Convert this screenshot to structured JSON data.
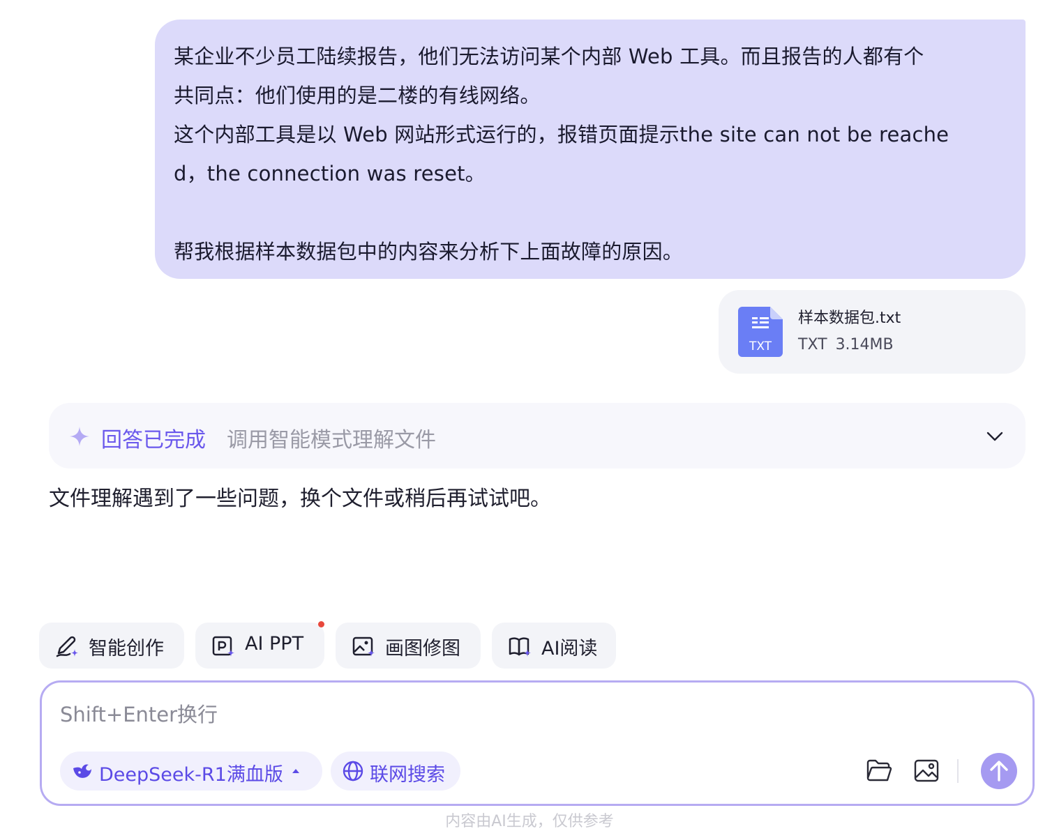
{
  "user_message": {
    "lines": [
      "某企业不少员工陆续报告，他们无法访问某个内部 Web 工具。而且报告的人都有个",
      "共同点：他们使用的是二楼的有线网络。",
      "这个内部工具是以 Web 网站形式运行的，报错页面提示the site can not be reache",
      "d，the connection was reset。",
      "",
      "帮我根据样本数据包中的内容来分析下上面故障的原因。"
    ]
  },
  "attachment": {
    "name": "样本数据包.txt",
    "type": "TXT",
    "size": "3.14MB",
    "icon": "txt-file-icon",
    "icon_label": "TXT",
    "accent": "#6a7ef5"
  },
  "response": {
    "status_title": "回答已完成",
    "status_subtitle": "调用智能模式理解文件",
    "answer_text": "文件理解遇到了一些问题，换个文件或稍后再试试吧。"
  },
  "tools": [
    {
      "label": "智能创作",
      "icon": "pen-sparkle-icon"
    },
    {
      "label": "AI PPT",
      "icon": "ppt-icon",
      "has_badge": true
    },
    {
      "label": "画图修图",
      "icon": "image-edit-icon"
    },
    {
      "label": "AI阅读",
      "icon": "book-read-icon"
    }
  ],
  "composer": {
    "placeholder": "Shift+Enter换行",
    "model_label": "DeepSeek-R1满血版",
    "model_icon": "deepseek-whale-icon",
    "web_search_label": "联网搜索",
    "web_search_icon": "globe-icon",
    "folder_icon": "folder-icon",
    "image_icon": "image-icon",
    "send_icon": "arrow-up-icon"
  },
  "footer": {
    "disclaimer": "内容由AI生成，仅供参考"
  },
  "colors": {
    "accent": "#6a58ec",
    "user_bubble": "#dcdafa",
    "composer_border": "#b6abf2",
    "send_button": "#a59af1",
    "badge": "#e8483c"
  }
}
